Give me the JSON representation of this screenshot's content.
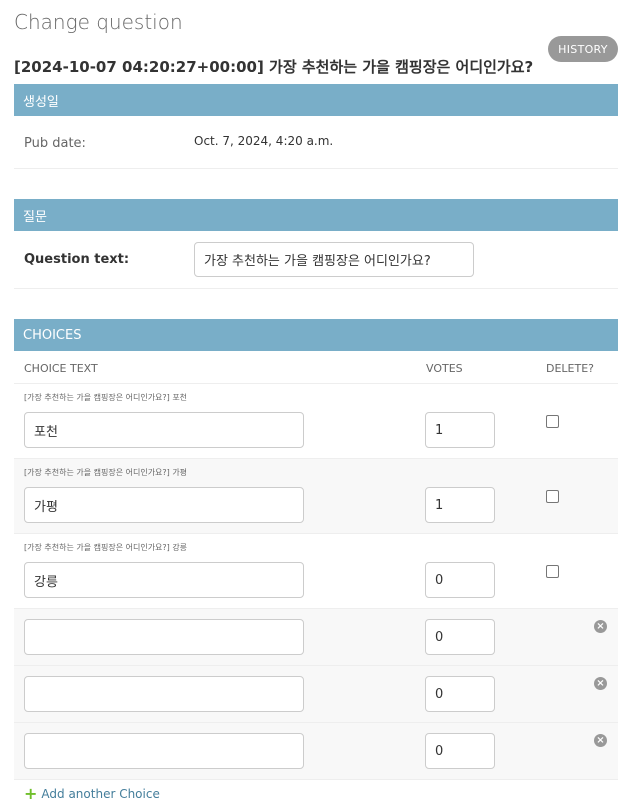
{
  "header": {
    "title": "Change question",
    "history_label": "HISTORY"
  },
  "object_title": "[2024-10-07 04:20:27+00:00] 가장 추천하는 가을 캠핑장은 어디인가요?",
  "fieldsets": {
    "date": {
      "heading": "생성일",
      "pub_date_label": "Pub date:",
      "pub_date_value": "Oct. 7, 2024, 4:20 a.m."
    },
    "question": {
      "heading": "질문",
      "question_text_label": "Question text:",
      "question_text_value": "가장 추천하는 가을 캠핑장은 어디인가요?"
    }
  },
  "choices": {
    "heading": "CHOICES",
    "columns": {
      "choice_text": "CHOICE TEXT",
      "votes": "VOTES",
      "delete": "DELETE?"
    },
    "rows": [
      {
        "caption": "[가장 추천하는 가을 캠핑장은 어디인가요?] 포천",
        "choice_text": "포천",
        "votes": "1",
        "deletable": true
      },
      {
        "caption": "[가장 추천하는 가을 캠핑장은 어디인가요?] 가평",
        "choice_text": "가평",
        "votes": "1",
        "deletable": true
      },
      {
        "caption": "[가장 추천하는 가을 캠핑장은 어디인가요?] 강릉",
        "choice_text": "강릉",
        "votes": "0",
        "deletable": true
      },
      {
        "caption": "",
        "choice_text": "",
        "votes": "0",
        "deletable": false
      },
      {
        "caption": "",
        "choice_text": "",
        "votes": "0",
        "deletable": false
      },
      {
        "caption": "",
        "choice_text": "",
        "votes": "0",
        "deletable": false
      }
    ],
    "add_label": "Add another Choice"
  },
  "icons": {
    "remove": "remove-inline-icon",
    "add": "plus-icon"
  },
  "colors": {
    "module_header": "#79aec8",
    "link": "#447e9b",
    "add_plus": "#70bf2b",
    "history_button": "#999999"
  }
}
